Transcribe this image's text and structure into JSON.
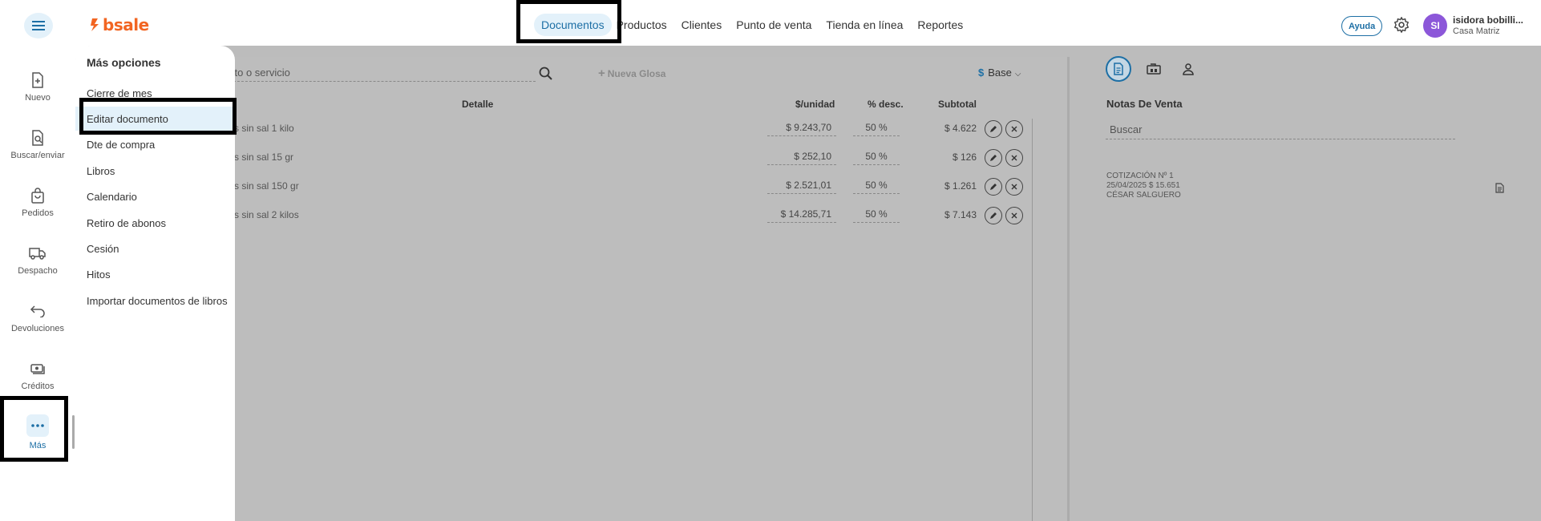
{
  "topbar": {
    "logo_text": "bsale",
    "nav": [
      {
        "label": "Documentos",
        "active": true
      },
      {
        "label": "Productos",
        "active": false
      },
      {
        "label": "Clientes",
        "active": false
      },
      {
        "label": "Punto de venta",
        "active": false
      },
      {
        "label": "Tienda en línea",
        "active": false
      },
      {
        "label": "Reportes",
        "active": false
      }
    ],
    "help_label": "Ayuda",
    "user": {
      "initials": "SI",
      "name": "isidora bobilli...",
      "branch": "Casa Matriz"
    }
  },
  "sidebar": {
    "items": [
      {
        "label": "Nuevo",
        "icon": "file-plus-icon"
      },
      {
        "label": "Buscar/enviar",
        "icon": "file-search-icon"
      },
      {
        "label": "Pedidos",
        "icon": "shopping-bag-icon"
      },
      {
        "label": "Despacho",
        "icon": "truck-icon"
      },
      {
        "label": "Devoluciones",
        "icon": "return-arrow-icon"
      },
      {
        "label": "Créditos",
        "icon": "cash-icon"
      },
      {
        "label": "Más",
        "icon": "more-dots-icon",
        "active": true
      }
    ]
  },
  "menu": {
    "title": "Más opciones",
    "items": [
      {
        "label": "Cierre de mes"
      },
      {
        "label": "Editar documento",
        "selected": true
      },
      {
        "label": "Dte de compra"
      },
      {
        "label": "Libros"
      },
      {
        "label": "Calendario"
      },
      {
        "label": "Retiro de abonos"
      },
      {
        "label": "Cesión"
      },
      {
        "label": "Hitos"
      },
      {
        "label": "Importar documentos de libros"
      }
    ]
  },
  "document": {
    "search_placeholder": "cto o servicio",
    "nueva_glosa": "Nueva Glosa",
    "price_list": "Base",
    "currency_symbol": "$",
    "headers": {
      "detail": "Detalle",
      "unit_price": "$/unidad",
      "discount": "% desc.",
      "subtotal": "Subtotal"
    },
    "rows": [
      {
        "detail": "s sin sal 1 kilo",
        "unit_price": "$ 9.243,70",
        "discount": "50 %",
        "subtotal": "$ 4.622"
      },
      {
        "detail": "s sin sal 15 gr",
        "unit_price": "$ 252,10",
        "discount": "50 %",
        "subtotal": "$ 126"
      },
      {
        "detail": "s sin sal 150 gr",
        "unit_price": "$ 2.521,01",
        "discount": "50 %",
        "subtotal": "$ 1.261"
      },
      {
        "detail": "s sin sal 2 kilos",
        "unit_price": "$ 14.285,71",
        "discount": "50 %",
        "subtotal": "$ 7.143"
      }
    ]
  },
  "right_panel": {
    "title": "Notas De Venta",
    "search_placeholder": "Buscar",
    "card": {
      "line1": "COTIZACIÓN Nº 1",
      "line2": "25/04/2025 $ 15.651",
      "line3": "CÉSAR SALGUERO"
    }
  },
  "colors": {
    "accent": "#1d6fa5",
    "brand": "#f26522",
    "avatar": "#8c57d9",
    "selected_bg": "#e3f1fa",
    "overlay": "#bcbcbc"
  }
}
